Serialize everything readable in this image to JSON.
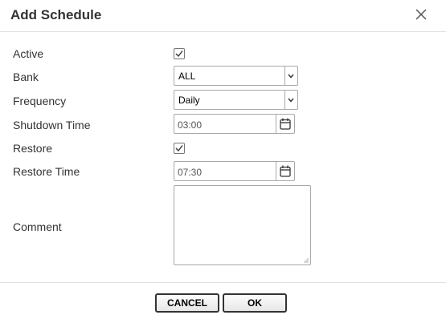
{
  "dialog": {
    "title": "Add Schedule",
    "close_icon": "close-icon"
  },
  "form": {
    "active": {
      "label": "Active",
      "checked": true
    },
    "bank": {
      "label": "Bank",
      "value": "ALL"
    },
    "frequency": {
      "label": "Frequency",
      "value": "Daily"
    },
    "shutdown_time": {
      "label": "Shutdown Time",
      "value": "03:00",
      "icon": "calendar-icon"
    },
    "restore": {
      "label": "Restore",
      "checked": true
    },
    "restore_time": {
      "label": "Restore Time",
      "value": "07:30",
      "icon": "calendar-icon"
    },
    "comment": {
      "label": "Comment",
      "value": ""
    }
  },
  "buttons": {
    "cancel": "CANCEL",
    "ok": "OK"
  }
}
